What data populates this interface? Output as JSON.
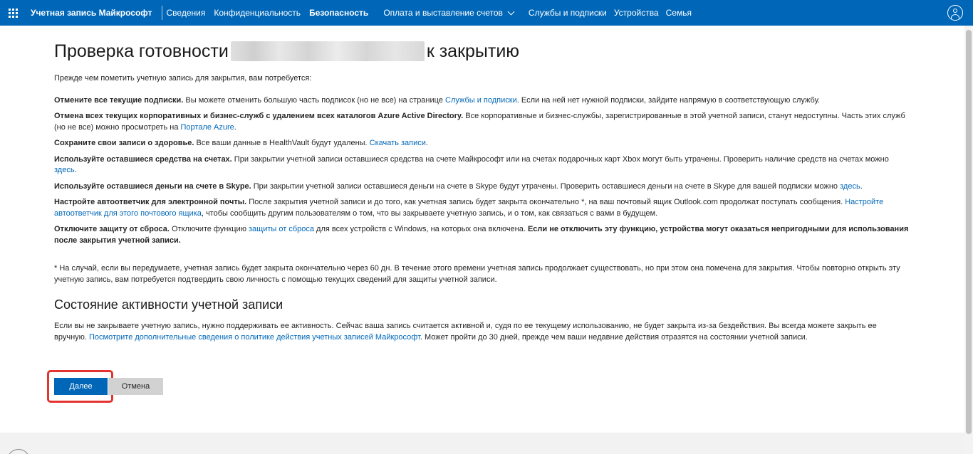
{
  "header": {
    "brand": "Учетная запись Майкрософт",
    "nav": [
      {
        "label": "Сведения"
      },
      {
        "label": "Конфиденциальность"
      },
      {
        "label": "Безопасность"
      },
      {
        "label": "Оплата и выставление счетов"
      },
      {
        "label": "Службы и подписки"
      },
      {
        "label": "Устройства"
      },
      {
        "label": "Семья"
      }
    ]
  },
  "page": {
    "title_prefix": "Проверка готовности",
    "title_suffix": "к закрытию",
    "intro": "Прежде чем пометить учетную запись для закрытия, вам потребуется:",
    "items": [
      {
        "bold": "Отмените все текущие подписки.",
        "text": " Вы можете отменить большую часть подписок (но не все) на странице ",
        "link": "Службы и подписки",
        "after": ". Если на ней нет нужной подписки, зайдите напрямую в соответствующую службу."
      },
      {
        "bold": "Отмена всех текущих корпоративных и бизнес-служб с удалением всех каталогов Azure Active Directory.",
        "text": " Все корпоративные и бизнес-службы, зарегистрированные в этой учетной записи, станут недоступны. Часть этих служб (но не все) можно просмотреть на ",
        "link": "Портале Azure",
        "after": "."
      },
      {
        "bold": "Сохраните свои записи о здоровье.",
        "text": " Все ваши данные в HealthVault будут удалены. ",
        "link": "Скачать записи",
        "after": "."
      },
      {
        "bold": "Используйте оставшиеся средства на счетах.",
        "text": " При закрытии учетной записи оставшиеся средства на счете Майкрософт или на счетах подарочных карт Xbox могут быть утрачены. Проверить наличие средств на счетах можно ",
        "link": "здесь",
        "after": "."
      },
      {
        "bold": "Используйте оставшиеся деньги на счете в Skype.",
        "text": " При закрытии учетной записи оставшиеся деньги на счете в Skype будут утрачены. Проверить оставшиеся деньги на счете в Skype для вашей подписки можно ",
        "link": "здесь",
        "after": "."
      },
      {
        "bold": "Настройте автоответчик для электронной почты.",
        "text": " После закрытия учетной записи и до того, как учетная запись будет закрыта окончательно *, на ваш почтовый ящик Outlook.com продолжат поступать сообщения. ",
        "link": "Настройте автоответчик для этого почтового ящика",
        "after": ", чтобы сообщить другим пользователям о том, что вы закрываете учетную запись, и о том, как связаться с вами в будущем."
      },
      {
        "bold": "Отключите защиту от сброса.",
        "text": " Отключите функцию ",
        "link": "защиты от сброса",
        "after": " для всех устройств с Windows, на которых она включена. ",
        "bold2": "Если не отключить эту функцию, устройства могут оказаться непригодными для использования после закрытия учетной записи."
      }
    ],
    "note": "* На случай, если вы передумаете, учетная запись будет закрыта окончательно через 60 дн. В течение этого времени учетная запись продолжает существовать, но при этом она помечена для закрытия. Чтобы повторно открыть эту учетную запись, вам потребуется подтвердить свою личность с помощью текущих сведений для защиты учетной записи.",
    "activity_heading": "Состояние активности учетной записи",
    "activity_text": "Если вы не закрываете учетную запись, нужно поддерживать ее активность. Сейчас ваша запись считается активной и, судя по ее текущему использованию, не будет закрыта из-за бездействия. Вы всегда можете закрыть ее вручную. ",
    "activity_link": "Посмотрите дополнительные сведения о политике действия учетных записей Майкрософт",
    "activity_after": ". Может пройти до 30 дней, прежде чем ваши недавние действия отразятся на состоянии учетной записи.",
    "next_label": "Далее",
    "cancel_label": "Отмена"
  },
  "colors": {
    "brand_blue": "#0067b8",
    "link": "#0067b8",
    "highlight": "#e5332f"
  },
  "icons": {
    "apps": "waffle-icon",
    "user": "avatar-icon",
    "dropdown": "chevron-down-icon"
  }
}
